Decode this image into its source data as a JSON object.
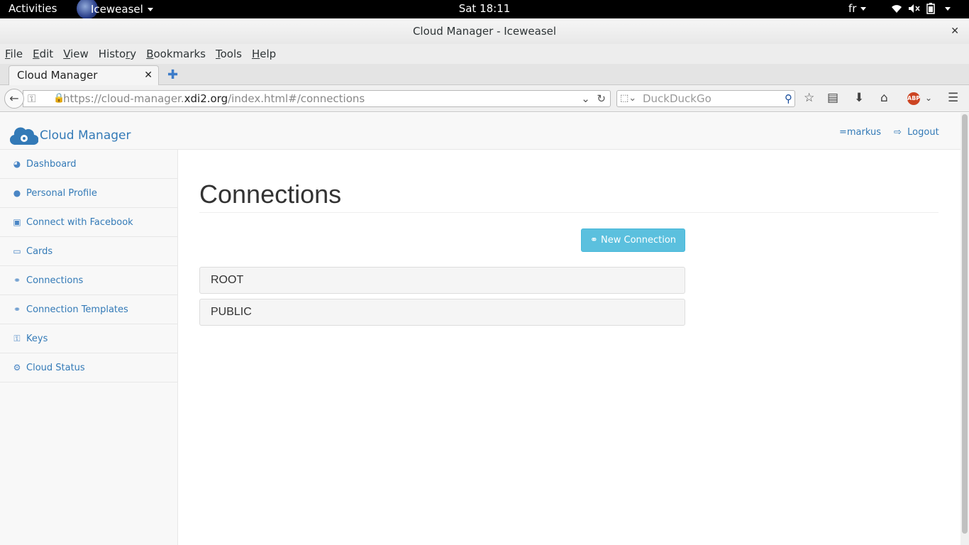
{
  "desktop": {
    "activities": "Activities",
    "app_name": "Iceweasel",
    "clock": "Sat 18:11",
    "language": "fr"
  },
  "window": {
    "title": "Cloud Manager - Iceweasel"
  },
  "menu": {
    "file": "File",
    "edit": "Edit",
    "view": "View",
    "history": "History",
    "bookmarks": "Bookmarks",
    "tools": "Tools",
    "help": "Help"
  },
  "tab": {
    "title": "Cloud Manager"
  },
  "navbar": {
    "url_prefix": "https://cloud-manager.",
    "url_domain": "xdi2.org",
    "url_suffix": "/index.html#/connections",
    "search_placeholder": "DuckDuckGo"
  },
  "app": {
    "brand": "Cloud Manager",
    "user": "=markus",
    "logout": "Logout",
    "sidebar": [
      {
        "label": "Dashboard",
        "icon": "dashboard-icon"
      },
      {
        "label": "Personal Profile",
        "icon": "user-icon"
      },
      {
        "label": "Connect with Facebook",
        "icon": "facebook-icon"
      },
      {
        "label": "Cards",
        "icon": "card-icon"
      },
      {
        "label": "Connections",
        "icon": "link-icon"
      },
      {
        "label": "Connection Templates",
        "icon": "link-icon"
      },
      {
        "label": "Keys",
        "icon": "key-icon"
      },
      {
        "label": "Cloud Status",
        "icon": "gears-icon"
      }
    ],
    "page_title": "Connections",
    "new_connection": "New Connection",
    "connections": [
      "ROOT",
      "PUBLIC"
    ],
    "colors": {
      "link": "#337ab7",
      "button": "#5bc0de"
    }
  }
}
